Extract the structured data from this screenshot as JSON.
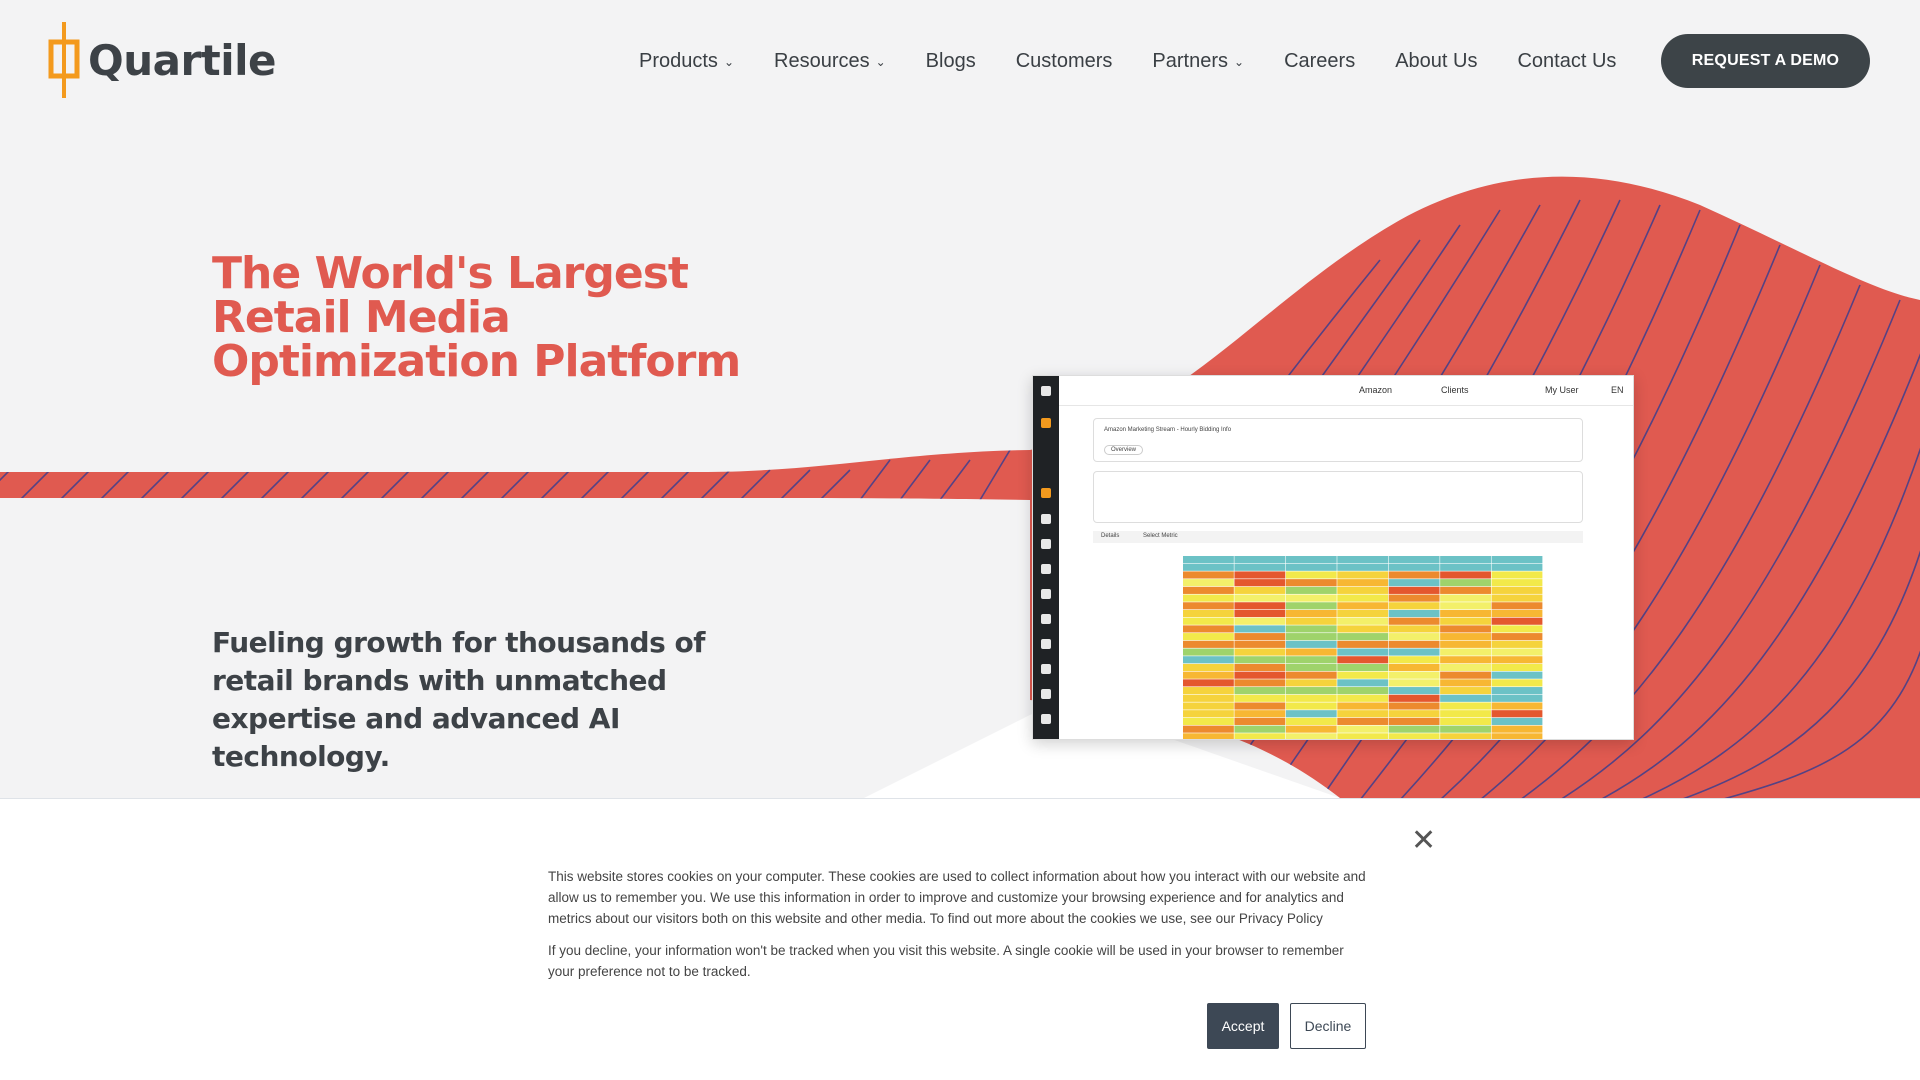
{
  "brand": {
    "name": "Quartile",
    "accent": "#e05a50",
    "logo_color": "#f39a1e"
  },
  "nav": {
    "items": [
      {
        "label": "Products",
        "has_dropdown": true
      },
      {
        "label": "Resources",
        "has_dropdown": true
      },
      {
        "label": "Blogs",
        "has_dropdown": false
      },
      {
        "label": "Customers",
        "has_dropdown": false
      },
      {
        "label": "Partners",
        "has_dropdown": true
      },
      {
        "label": "Careers",
        "has_dropdown": false
      },
      {
        "label": "About Us",
        "has_dropdown": false
      },
      {
        "label": "Contact Us",
        "has_dropdown": false
      }
    ],
    "cta": "REQUEST A DEMO"
  },
  "hero": {
    "title": "The World's Largest Retail Media Optimization Platform",
    "subtitle": "Fueling growth for thousands of retail brands with unmatched expertise and advanced AI technology."
  },
  "dashboard": {
    "marketplace": "Amazon",
    "clients": "Clients",
    "user": "My User",
    "language": "EN",
    "panel_title": "Amazon Marketing Stream - Hourly Bidding Info",
    "overview_tab": "Overview",
    "details_label": "Details",
    "select_metric": "Select Metric"
  },
  "cookie": {
    "text1": "This website stores cookies on your computer. These cookies are used to collect information about how you interact with our website and allow us to remember you. We use this information in order to improve and customize your browsing experience and for analytics and metrics about our visitors both on this website and other media. To find out more about the cookies we use, see our Privacy Policy",
    "text2": "If you decline, your information won't be tracked when you visit this website. A single cookie will be used in your browser to remember your preference not to be tracked.",
    "accept": "Accept",
    "decline": "Decline"
  }
}
